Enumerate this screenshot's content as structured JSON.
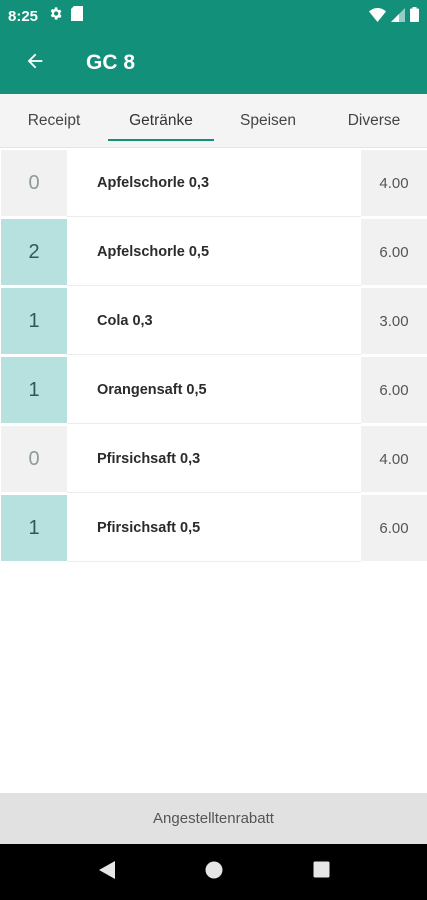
{
  "status_bar": {
    "time": "8:25",
    "icons": [
      "settings-icon",
      "sd-card-icon",
      "wifi-icon",
      "signal-icon",
      "battery-icon"
    ]
  },
  "app_bar": {
    "title": "GC 8",
    "back_icon": "arrow-back-icon"
  },
  "tabs": [
    {
      "label": "Receipt",
      "selected": false
    },
    {
      "label": "Getränke",
      "selected": true
    },
    {
      "label": "Speisen",
      "selected": false
    },
    {
      "label": "Diverse",
      "selected": false
    }
  ],
  "items": [
    {
      "qty": "0",
      "name": "Apfelschorle 0,3",
      "price": "4.00"
    },
    {
      "qty": "2",
      "name": "Apfelschorle 0,5",
      "price": "6.00"
    },
    {
      "qty": "1",
      "name": "Cola 0,3",
      "price": "3.00"
    },
    {
      "qty": "1",
      "name": "Orangensaft 0,5",
      "price": "6.00"
    },
    {
      "qty": "0",
      "name": "Pfirsichsaft 0,3",
      "price": "4.00"
    },
    {
      "qty": "1",
      "name": "Pfirsichsaft 0,5",
      "price": "6.00"
    }
  ],
  "bottom_button": {
    "label": "Angestelltenrabatt"
  },
  "nav_bar": {
    "icons": [
      "back-triangle-icon",
      "home-circle-icon",
      "recents-square-icon"
    ]
  },
  "colors": {
    "primary": "#12907a",
    "qty_selected_bg": "#b6e1de",
    "cell_bg": "#f1f1f1"
  }
}
